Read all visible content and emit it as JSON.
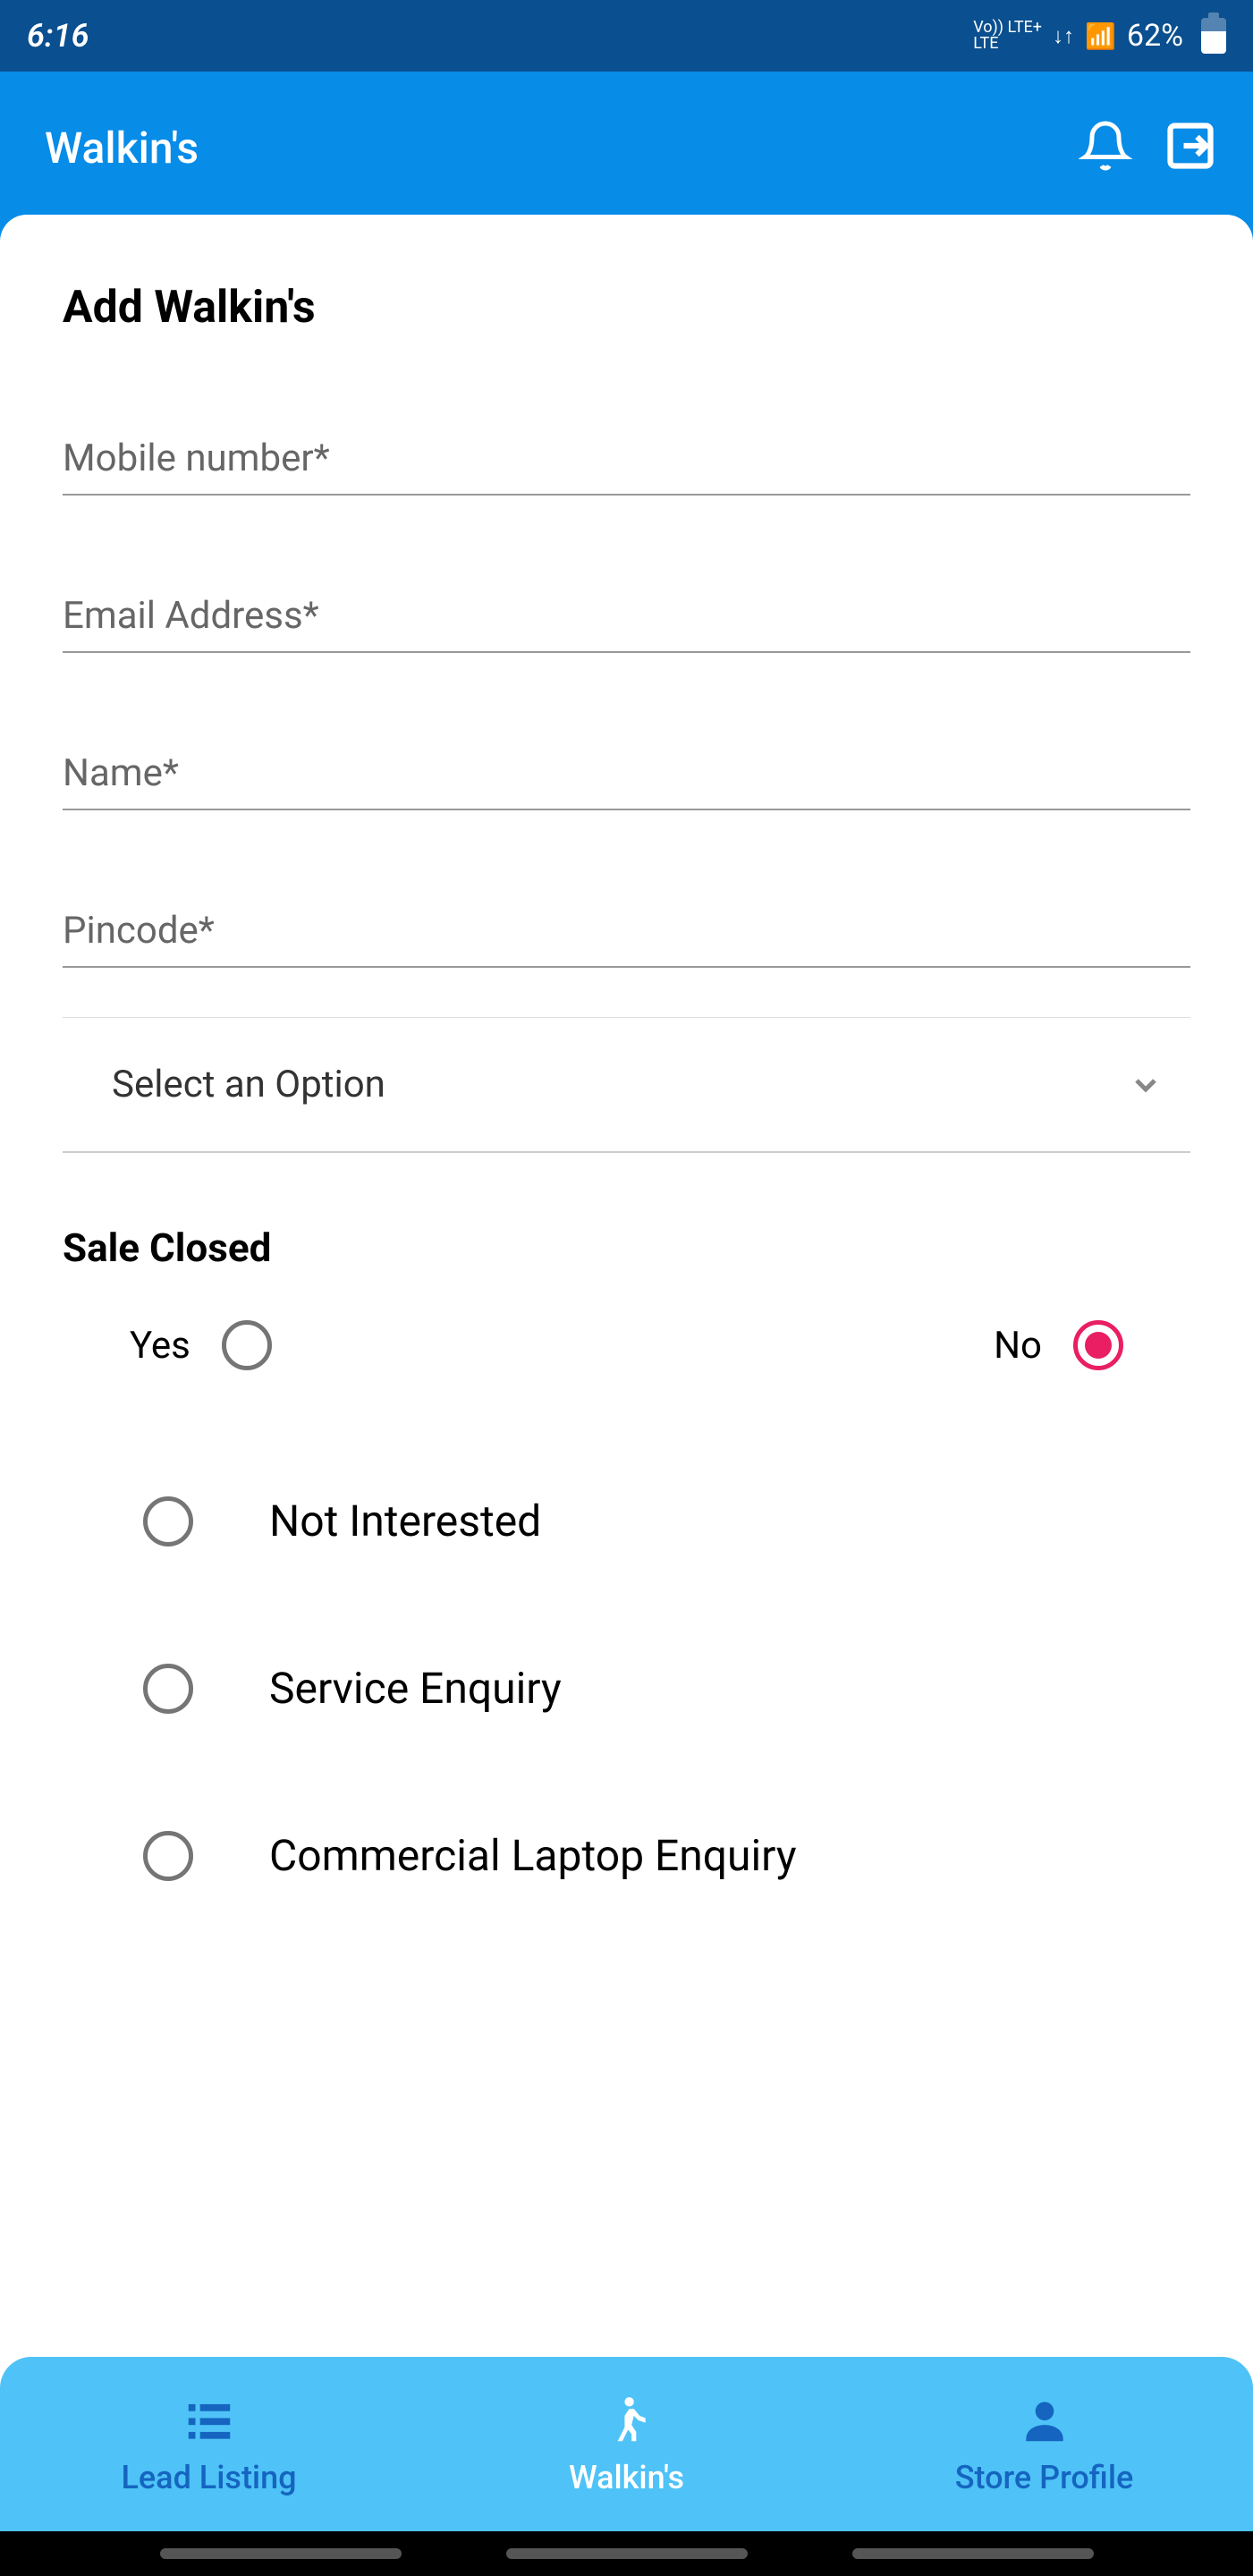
{
  "statusBar": {
    "time": "6:16",
    "lteLine1": "Vo)) LTE+",
    "lteLine2": "LTE",
    "battery": "62%"
  },
  "header": {
    "title": "Walkin's"
  },
  "page": {
    "title": "Add Walkin's"
  },
  "fields": {
    "mobile": {
      "placeholder": "Mobile number*"
    },
    "email": {
      "placeholder": "Email Address*"
    },
    "name": {
      "placeholder": "Name*"
    },
    "pincode": {
      "placeholder": "Pincode*"
    },
    "select": {
      "text": "Select an Option"
    }
  },
  "saleClosed": {
    "title": "Sale Closed",
    "yesLabel": "Yes",
    "noLabel": "No"
  },
  "options": {
    "opt1": "Not Interested",
    "opt2": "Service Enquiry",
    "opt3": "Commercial Laptop Enquiry"
  },
  "bottomNav": {
    "leadListing": "Lead Listing",
    "walkins": "Walkin's",
    "storeProfile": "Store Profile"
  }
}
